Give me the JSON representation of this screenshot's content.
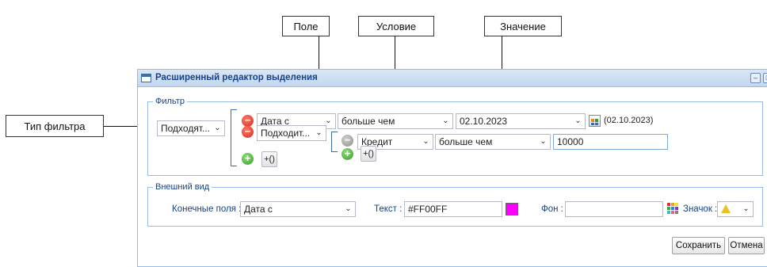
{
  "annotations": {
    "field": "Поле",
    "condition": "Условие",
    "value": "Значение",
    "filter_type": "Тип фильтра"
  },
  "window": {
    "title": "Расширенный редактор выделения"
  },
  "filter": {
    "legend": "Фильтр",
    "root_type": "Подходят...",
    "row1": {
      "field": "Дата с",
      "condition": "больше чем",
      "value": "02.10.2023",
      "preview": "(02.10.2023)"
    },
    "group_type": "Подходит...",
    "row2": {
      "field": "Кредит",
      "condition": "больше чем",
      "value": "10000"
    },
    "group_label": "+()"
  },
  "appearance": {
    "legend": "Внешний вид",
    "end_fields_label": "Конечные поля :",
    "end_fields_value": "Дата с",
    "text_label": "Текст :",
    "text_value": "#FF00FF",
    "text_color": "#FF00FF",
    "bg_label": "Фон :",
    "bg_value": "",
    "icon_label": "Значок :"
  },
  "buttons": {
    "save": "Сохранить",
    "cancel": "Отмена"
  }
}
